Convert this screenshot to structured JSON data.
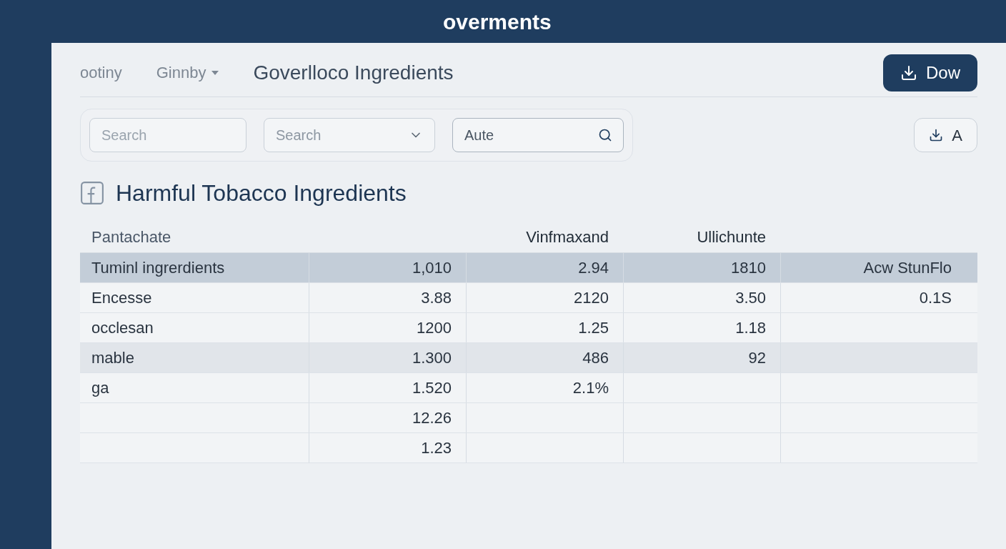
{
  "header": {
    "title": "overments"
  },
  "nav": {
    "items": [
      {
        "label": "ootiny",
        "kind": "link"
      },
      {
        "label": "Ginnby",
        "kind": "dropdown"
      }
    ],
    "page_title": "Goverlloco Ingredients",
    "download_button": {
      "label": "Dow"
    }
  },
  "toolbar": {
    "search": {
      "placeholder": "Search"
    },
    "select": {
      "placeholder": "Search"
    },
    "filter": {
      "value": "Aute"
    },
    "secondary_button": {
      "label": "A"
    }
  },
  "heading": "Harmful Tobacco Ingredients",
  "table": {
    "columns": [
      "Pantachate",
      null,
      "Vinfmaxand",
      "Ullichunte",
      null
    ],
    "rows": [
      {
        "cells": [
          "Tuminl ingrerdients",
          "1,010",
          "2.94",
          "1810",
          "Acw StunFlo"
        ],
        "selected": true,
        "hovered": false
      },
      {
        "cells": [
          "Encesse",
          "3.88",
          "2120",
          "3.50",
          "0.1S"
        ],
        "selected": false,
        "hovered": false
      },
      {
        "cells": [
          "occlesan",
          "1200",
          "1.25",
          "1.18",
          null
        ],
        "selected": false,
        "hovered": false
      },
      {
        "cells": [
          "mable",
          "1.300",
          "486",
          "92",
          null
        ],
        "selected": false,
        "hovered": true
      },
      {
        "cells": [
          "ga",
          "1.520",
          "2.1%",
          null,
          null
        ],
        "selected": false,
        "hovered": false
      },
      {
        "cells": [
          null,
          "12.26",
          null,
          null,
          null
        ],
        "selected": false,
        "hovered": false
      },
      {
        "cells": [
          null,
          "1.23",
          null,
          null,
          null
        ],
        "selected": false,
        "hovered": false
      }
    ]
  }
}
